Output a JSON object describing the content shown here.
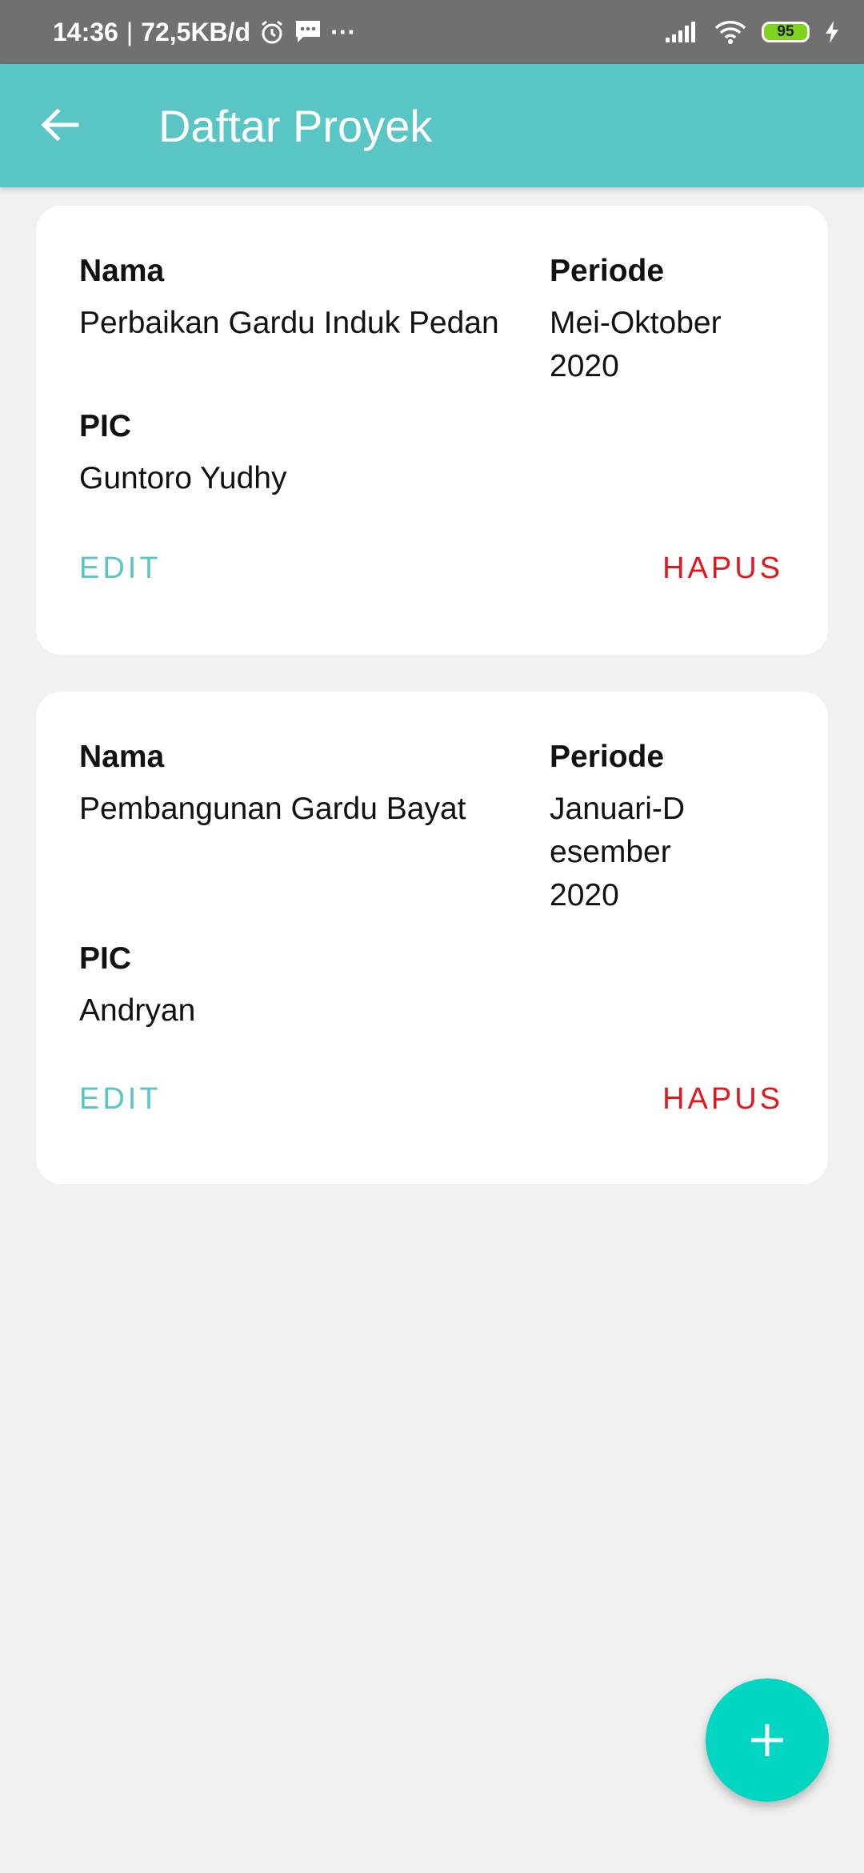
{
  "status_bar": {
    "time": "14:36",
    "separator": "|",
    "network_speed": "72,5KB/d",
    "overflow": "···",
    "battery_level": "95",
    "icons": [
      "alarm-icon",
      "message-icon",
      "signal-icon",
      "wifi-icon",
      "battery-icon",
      "charging-icon"
    ]
  },
  "app_bar": {
    "title": "Daftar Proyek",
    "back_icon": "arrow-left-icon"
  },
  "labels": {
    "name": "Nama",
    "period": "Periode",
    "pic": "PIC",
    "edit": "EDIT",
    "delete": "HAPUS"
  },
  "projects": [
    {
      "name": "Perbaikan Gardu Induk Pedan",
      "period": "Mei-Oktober 2020",
      "pic": "Guntoro Yudhy"
    },
    {
      "name": "Pembangunan Gardu Bayat",
      "period_lines": [
        "Januari-D",
        "esember",
        "2020"
      ],
      "pic": "Andryan"
    }
  ],
  "fab": {
    "icon": "plus-icon"
  },
  "colors": {
    "primary": "#5ac5c5",
    "fab": "#00d6c2",
    "danger": "#e0181e",
    "background": "#f1f1f1"
  }
}
